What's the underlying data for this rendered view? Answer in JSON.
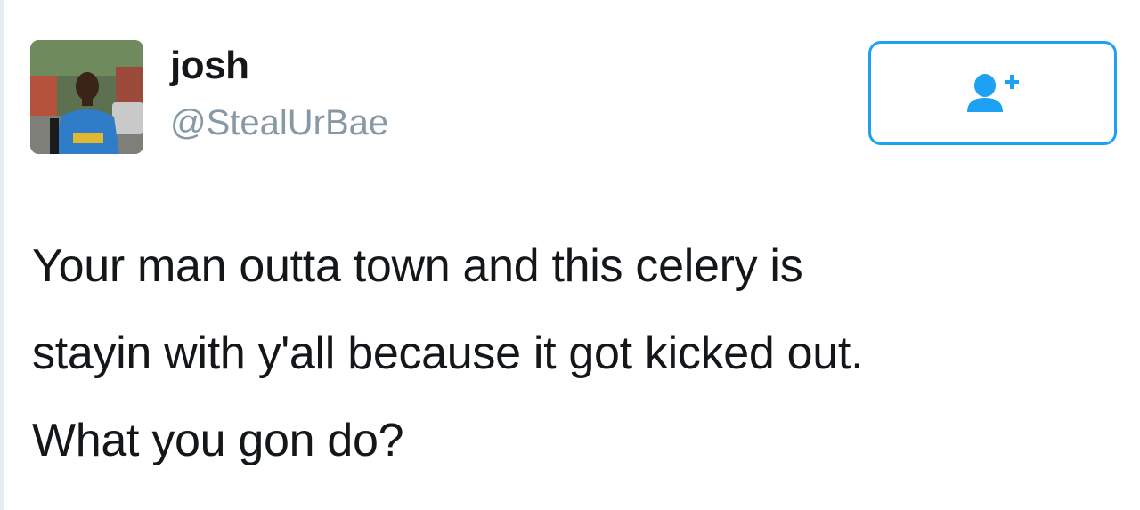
{
  "tweet": {
    "author": {
      "display_name": "josh",
      "handle": "@StealUrBae",
      "avatar_icon": "user-photo-avatar"
    },
    "follow_button": {
      "icon": "add-user-icon",
      "accent_color": "#1da1f2"
    },
    "text": "Your man outta town and this celery is\nstayin with y'all because it got kicked out.\nWhat you gon do?"
  }
}
